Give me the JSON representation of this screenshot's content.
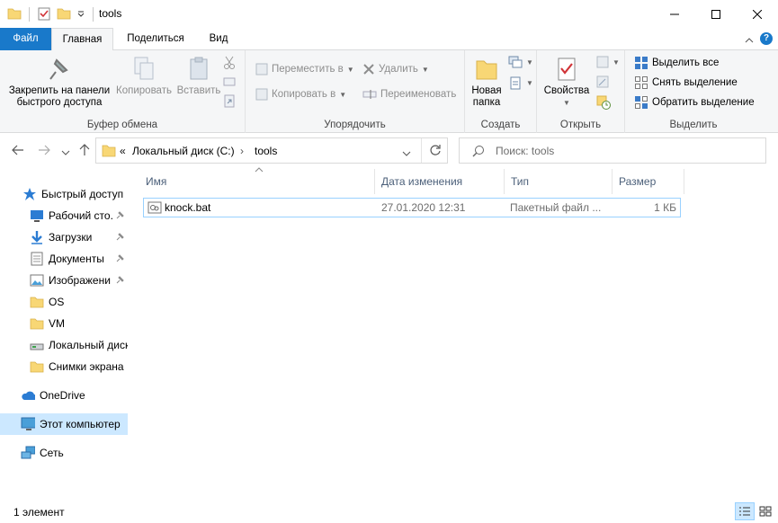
{
  "window": {
    "title": "tools"
  },
  "tabs": [
    {
      "label": "Файл"
    },
    {
      "label": "Главная"
    },
    {
      "label": "Поделиться"
    },
    {
      "label": "Вид"
    }
  ],
  "ribbon": {
    "clipboard": {
      "pin_label": "Закрепить на панели быстрого доступа",
      "copy_label": "Копировать",
      "paste_label": "Вставить",
      "group_label": "Буфер обмена"
    },
    "organize": {
      "move_label": "Переместить в",
      "copy_to_label": "Копировать в",
      "delete_label": "Удалить",
      "rename_label": "Переименовать",
      "group_label": "Упорядочить"
    },
    "new": {
      "new_folder_label": "Новая папка",
      "group_label": "Создать"
    },
    "open": {
      "properties_label": "Свойства",
      "group_label": "Открыть"
    },
    "select": {
      "select_all_label": "Выделить все",
      "select_none_label": "Снять выделение",
      "invert_label": "Обратить выделение",
      "group_label": "Выделить"
    }
  },
  "address": {
    "overflow": "«",
    "segments": [
      "Локальный диск (C:)",
      "tools"
    ]
  },
  "search": {
    "placeholder": "Поиск: tools"
  },
  "nav": {
    "quick_access": "Быстрый доступ",
    "items": [
      {
        "label": "Рабочий сто.",
        "pinned": true
      },
      {
        "label": "Загрузки",
        "pinned": true
      },
      {
        "label": "Документы",
        "pinned": true
      },
      {
        "label": "Изображени",
        "pinned": true
      },
      {
        "label": "OS",
        "pinned": false
      },
      {
        "label": "VM",
        "pinned": false
      },
      {
        "label": "Локальный диск",
        "pinned": false
      },
      {
        "label": "Снимки экрана",
        "pinned": false
      }
    ],
    "onedrive": "OneDrive",
    "this_pc": "Этот компьютер",
    "network": "Сеть"
  },
  "columns": {
    "name": "Имя",
    "date": "Дата изменения",
    "type": "Тип",
    "size": "Размер"
  },
  "files": [
    {
      "name": "knock.bat",
      "date": "27.01.2020 12:31",
      "type": "Пакетный файл ...",
      "size": "1 КБ"
    }
  ],
  "status": {
    "count": "1 элемент"
  },
  "colors": {
    "file_tab": "#1979ca",
    "selection": "#cce8ff",
    "folder": "#f8d775"
  }
}
